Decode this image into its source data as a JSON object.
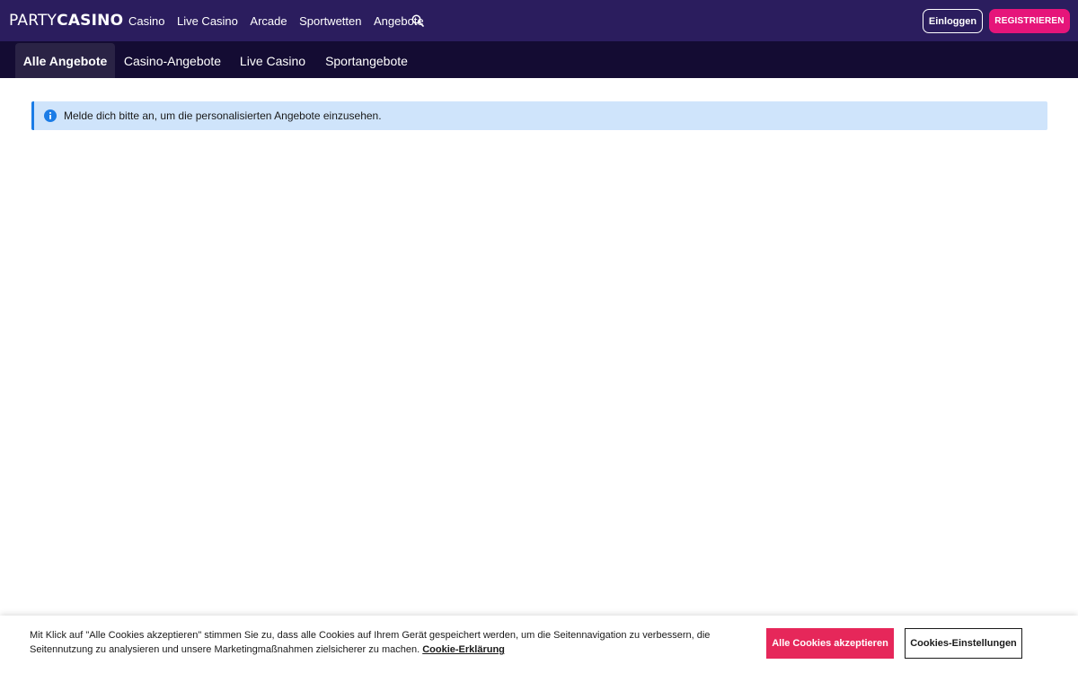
{
  "header": {
    "logo_part1": "PARTY",
    "logo_part2": "CASINO",
    "nav": [
      "Casino",
      "Live Casino",
      "Arcade",
      "Sportwetten",
      "Angebote"
    ],
    "login_label": "Einloggen",
    "register_label": "REGISTRIEREN",
    "search_icon": "search-icon"
  },
  "subnav": {
    "tabs": [
      {
        "label": "Alle Angebote",
        "active": true
      },
      {
        "label": "Casino-Angebote",
        "active": false
      },
      {
        "label": "Live Casino",
        "active": false
      },
      {
        "label": "Sportangebote",
        "active": false
      }
    ]
  },
  "notice": {
    "icon": "info-icon",
    "text": "Melde dich bitte an, um die personalisierten Angebote einzusehen."
  },
  "cookie_banner": {
    "text": "Mit Klick auf \"Alle Cookies akzeptieren\" stimmen Sie zu, dass alle Cookies auf Ihrem Gerät gespeichert werden, um die Seitennavigation zu verbessern, die Seitennutzung zu analysieren und unsere Marketingmaßnahmen zielsicherer zu machen.",
    "link_label": "Cookie-Erklärung",
    "accept_label": "Alle Cookies akzeptieren",
    "settings_label": "Cookies-Einstellungen"
  },
  "colors": {
    "topbar": "#2b1d5e",
    "subnav": "#140c33",
    "register": "#e6157a",
    "accept": "#e6275a",
    "info_bg": "#cfe4fb",
    "info_accent": "#1b7ce6"
  }
}
